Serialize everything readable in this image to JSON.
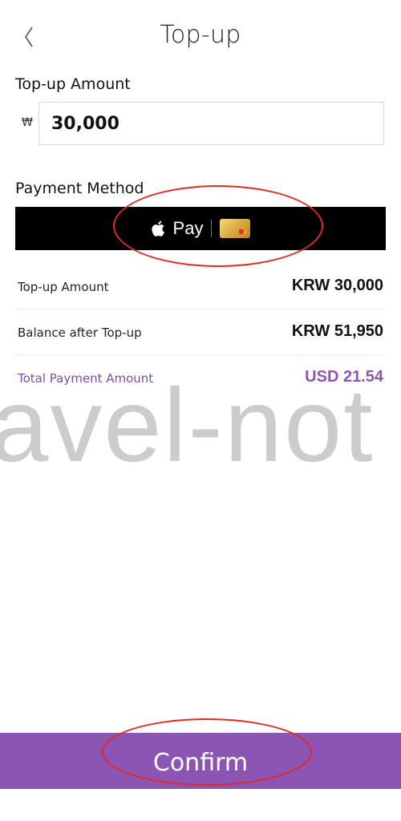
{
  "header": {
    "title": "Top-up"
  },
  "amount_section": {
    "label": "Top-up Amount",
    "currency_symbol": "₩",
    "value": "30,000"
  },
  "payment_section": {
    "label": "Payment Method",
    "method_text": "Pay",
    "brand_color": "#000000"
  },
  "summary": [
    {
      "label": "Top-up Amount",
      "value": "KRW 30,000"
    },
    {
      "label": "Balance after Top-up",
      "value": "KRW 51,950"
    },
    {
      "label": "Total Payment Amount",
      "value": "USD 21.54"
    }
  ],
  "watermark": "avel-not",
  "confirm": {
    "label": "Confirm",
    "color": "#8c55b3"
  },
  "colors": {
    "accent": "#8c55b3",
    "annotation": "#e02a22"
  }
}
